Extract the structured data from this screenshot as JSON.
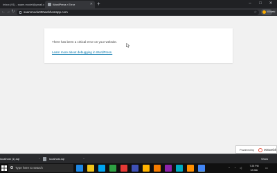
{
  "browser": {
    "tabs": [
      {
        "label": "Inbox (91) - saam.model@gmail.c"
      },
      {
        "label": "WordPress › Error"
      }
    ],
    "new_tab": "+",
    "window_controls": [
      "–",
      "□",
      "✕"
    ],
    "url": "saammodu000webhostapp.com",
    "extension_label": "000web"
  },
  "page": {
    "error_message": "There has been a critical error on your website.",
    "learn_more_link": "Learn more about debugging in WordPress.",
    "powered_by": "Powered by",
    "brand": "000webh"
  },
  "downloads": {
    "items": [
      {
        "label": "localhost (1).sql"
      },
      {
        "label": "localhost.sql"
      }
    ],
    "show_all": "Show"
  },
  "taskbar": {
    "search_placeholder": "Type here to search",
    "clock": {
      "time": "7:25 PM",
      "date": "12-Mar"
    },
    "pinned_colors": [
      "#1e88e5",
      "#f0c419",
      "#00a4ef",
      "#2ea043",
      "#e53935",
      "#3f51b5",
      "#ffb300",
      "#f57c00",
      "#8e24aa",
      "#00acc1",
      "#ff8f00",
      "#4285f4"
    ]
  },
  "colors": {
    "link": "#0073aa",
    "page_background": "#f1f1f1",
    "chrome_dark": "#202124",
    "brand_accent": "#e8513d"
  }
}
